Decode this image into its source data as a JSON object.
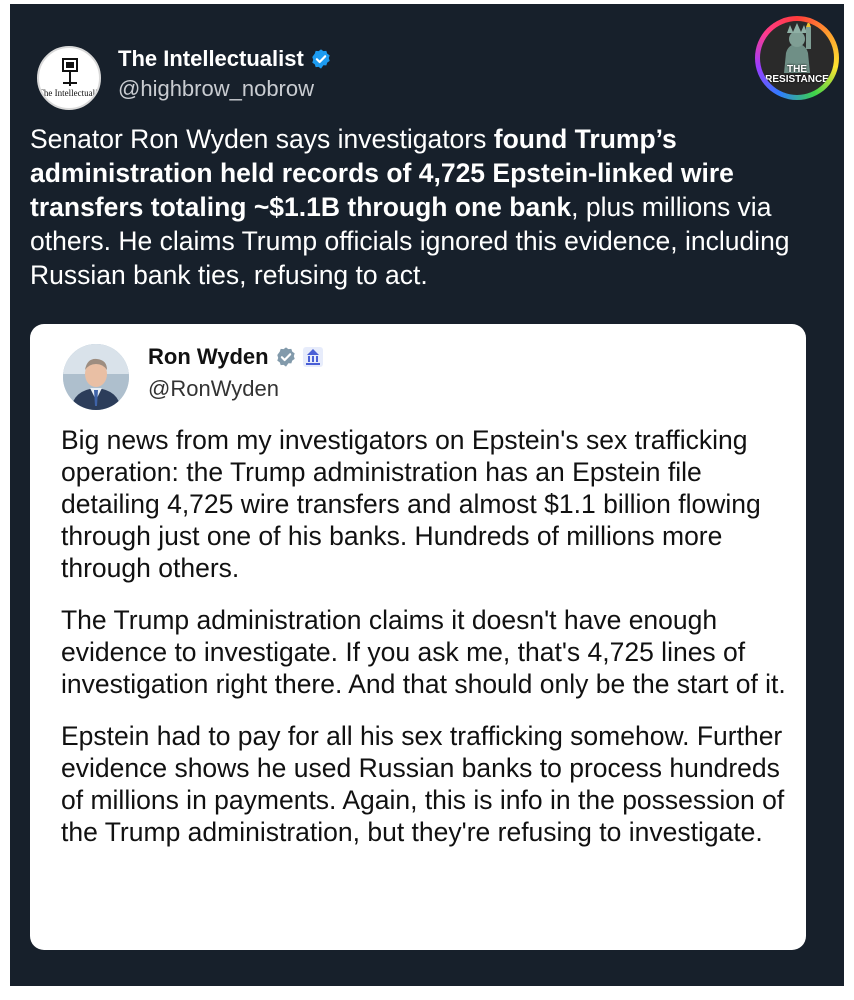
{
  "tweet": {
    "author_name": "The Intellectualist",
    "author_handle": "@highbrow_nobrow",
    "avatar_text": "The Intellectualist",
    "text_parts": [
      {
        "text": "Senator Ron Wyden says investigators ",
        "bold": false
      },
      {
        "text": "found Trump’s administration held records of 4,725 Epstein-linked wire transfers totaling ~$1.1B through one bank",
        "bold": true
      },
      {
        "text": ", plus millions via others. He claims Trump officials ignored this evidence, including Russian bank ties, refusing to act.",
        "bold": false
      }
    ]
  },
  "badge": {
    "text_line1": "THE",
    "text_line2": "RESISTANCE"
  },
  "quoted": {
    "author_name": "Ron Wyden",
    "author_handle": "@RonWyden",
    "paragraphs": [
      "Big news from my investigators on Epstein's sex trafficking operation: the Trump administration has an Epstein file detailing 4,725 wire transfers and almost $1.1 billion flowing through just one of his banks. Hundreds of millions more through others.",
      "The Trump administration claims it doesn't have enough evidence to investigate. If you ask me, that's 4,725 lines of investigation right there. And that should only be the start of it.",
      "Epstein had to pay for all his sex trafficking somehow. Further evidence shows he used Russian banks to process hundreds of millions in payments. Again, this is info in the possession of the Trump administration, but they're refusing to investigate."
    ]
  },
  "colors": {
    "background": "#17202b",
    "verified_blue": "#1d9bf0",
    "verified_gray": "#829aab",
    "gov_badge": "#4a5fd6"
  },
  "icons": [
    "verified-badge-icon",
    "gray-verified-badge-icon",
    "government-building-icon"
  ]
}
